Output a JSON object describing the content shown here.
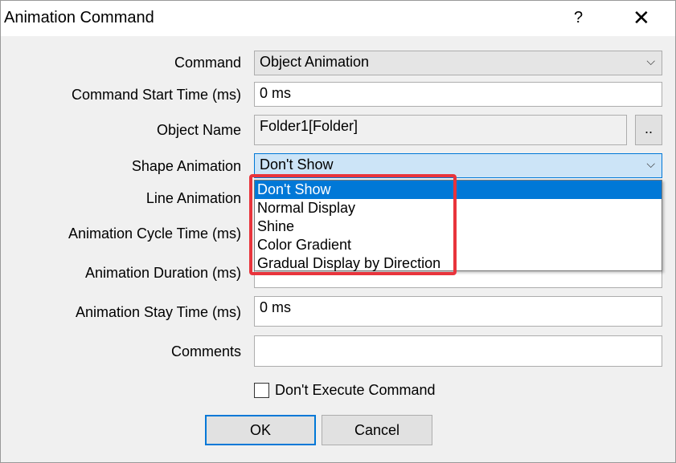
{
  "window": {
    "title": "Animation Command",
    "help_glyph": "?",
    "close_glyph": "✕"
  },
  "form": {
    "command": {
      "label": "Command",
      "value": "Object Animation"
    },
    "start_time": {
      "label": "Command Start Time (ms)",
      "value": "0 ms"
    },
    "object_name": {
      "label": "Object Name",
      "value": "Folder1[Folder]",
      "browse_label": ".."
    },
    "shape_animation": {
      "label": "Shape Animation",
      "value": "Don't Show"
    },
    "line_animation": {
      "label": "Line Animation"
    },
    "cycle_time": {
      "label": "Animation Cycle Time (ms)"
    },
    "duration": {
      "label": "Animation Duration (ms)"
    },
    "stay_time": {
      "label": "Animation Stay Time (ms)",
      "value": "0 ms"
    },
    "comments": {
      "label": "Comments",
      "value": ""
    }
  },
  "dropdown": {
    "options": [
      "Don't Show",
      "Normal Display",
      "Shine",
      "Color Gradient",
      "Gradual Display by Direction"
    ],
    "selected_index": 0
  },
  "checkbox": {
    "label": "Don't Execute Command",
    "checked": false
  },
  "buttons": {
    "ok": "OK",
    "cancel": "Cancel"
  },
  "icons": {
    "dropdown_arrow": "chevron-down-icon"
  },
  "colors": {
    "selection": "#0078d7",
    "highlight_box": "#e8343c"
  }
}
